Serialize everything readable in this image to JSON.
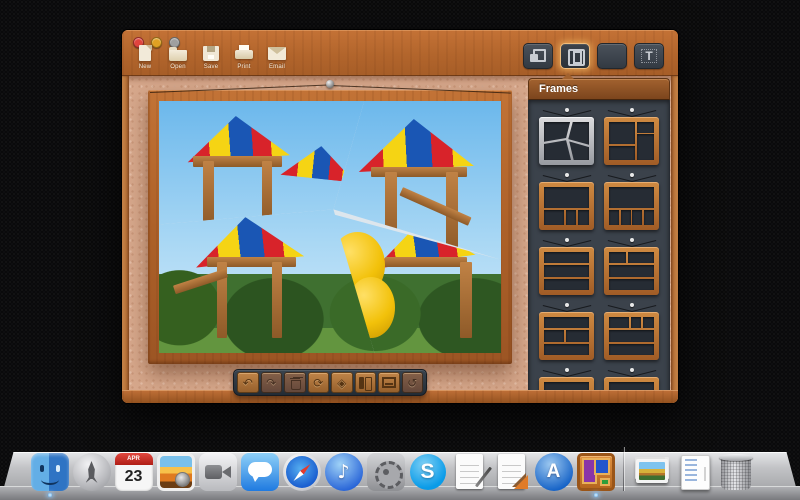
{
  "colors": {
    "wood_accent": "#b5692f",
    "cork": "#d7a88c",
    "panel_dark": "#3b424b",
    "selection_glow": "#eba95a"
  },
  "window": {
    "traffic_lights": [
      {
        "id": "close",
        "color": "#e0443e"
      },
      {
        "id": "minimize",
        "color": "#dfa123"
      },
      {
        "id": "zoom",
        "color": "#9f9f9f"
      }
    ],
    "toolbar": {
      "items": [
        {
          "id": "new",
          "label": "New"
        },
        {
          "id": "open",
          "label": "Open"
        },
        {
          "id": "save",
          "label": "Save"
        },
        {
          "id": "print",
          "label": "Print"
        },
        {
          "id": "email",
          "label": "Email"
        }
      ]
    },
    "view_buttons": [
      {
        "id": "layouts",
        "selected": false
      },
      {
        "id": "frames",
        "selected": true
      },
      {
        "id": "adjustments",
        "selected": false
      },
      {
        "id": "text",
        "glyph": "T",
        "selected": false
      }
    ],
    "frames_panel": {
      "title": "Frames",
      "thumbnails": [
        {
          "id": "diagonal-collage",
          "selected": true,
          "diagonal": true
        },
        {
          "id": "hero-left-right-column",
          "selected": false,
          "cells": [
            [
              0,
              0,
              58,
              58
            ],
            [
              62,
              0,
              38,
              28
            ],
            [
              62,
              32,
              38,
              68
            ],
            [
              0,
              62,
              58,
              38
            ]
          ]
        },
        {
          "id": "top-hero-bottom-three",
          "selected": false,
          "cells": [
            [
              0,
              0,
              100,
              55
            ],
            [
              0,
              60,
              44,
              40
            ],
            [
              48,
              60,
              24,
              40
            ],
            [
              76,
              60,
              24,
              40
            ]
          ]
        },
        {
          "id": "top-hero-bottom-four",
          "selected": false,
          "cells": [
            [
              0,
              0,
              100,
              55
            ],
            [
              0,
              60,
              22,
              40
            ],
            [
              26,
              60,
              22,
              40
            ],
            [
              52,
              60,
              22,
              40
            ],
            [
              78,
              60,
              22,
              40
            ]
          ]
        },
        {
          "id": "three-rows",
          "selected": false,
          "cells": [
            [
              0,
              0,
              100,
              30
            ],
            [
              0,
              35,
              100,
              30
            ],
            [
              0,
              70,
              100,
              30
            ]
          ]
        },
        {
          "id": "split-top-two-rows",
          "selected": false,
          "cells": [
            [
              0,
              0,
              38,
              30
            ],
            [
              42,
              0,
              58,
              30
            ],
            [
              0,
              35,
              100,
              30
            ],
            [
              0,
              70,
              100,
              30
            ]
          ]
        },
        {
          "id": "row-split-middle-row",
          "selected": false,
          "cells": [
            [
              0,
              0,
              100,
              30
            ],
            [
              0,
              35,
              44,
              30
            ],
            [
              48,
              35,
              52,
              30
            ],
            [
              0,
              70,
              100,
              30
            ]
          ]
        },
        {
          "id": "top-three-two-rows",
          "selected": false,
          "cells": [
            [
              0,
              0,
              44,
              30
            ],
            [
              48,
              0,
              24,
              30
            ],
            [
              76,
              0,
              24,
              30
            ],
            [
              0,
              35,
              100,
              30
            ],
            [
              0,
              70,
              100,
              30
            ]
          ]
        },
        {
          "id": "row-bottom-grid",
          "selected": false,
          "cells": [
            [
              0,
              0,
              100,
              30
            ],
            [
              0,
              35,
              46,
              30
            ],
            [
              50,
              35,
              50,
              30
            ],
            [
              0,
              70,
              46,
              30
            ],
            [
              50,
              70,
              50,
              30
            ]
          ]
        },
        {
          "id": "row-hero-right-column",
          "selected": false,
          "cells": [
            [
              0,
              0,
              100,
              30
            ],
            [
              0,
              35,
              62,
              65
            ],
            [
              66,
              35,
              34,
              29
            ],
            [
              66,
              68,
              34,
              32
            ]
          ]
        }
      ]
    },
    "tray": {
      "buttons": [
        {
          "id": "undo",
          "glyph": "↶",
          "enabled": true
        },
        {
          "id": "redo",
          "glyph": "↷",
          "enabled": false
        },
        {
          "id": "delete",
          "glyph": "",
          "enabled": false
        },
        {
          "id": "rotate",
          "glyph": "⟳",
          "enabled": true
        },
        {
          "id": "orientation",
          "glyph": "◈",
          "enabled": true
        },
        {
          "id": "swap",
          "glyph": "",
          "enabled": true
        },
        {
          "id": "border",
          "glyph": "",
          "enabled": true
        },
        {
          "id": "reset",
          "glyph": "↺",
          "enabled": false
        }
      ]
    }
  },
  "dock": {
    "items": [
      {
        "type": "app",
        "id": "finder",
        "running": true
      },
      {
        "type": "app",
        "id": "launchpad",
        "running": false
      },
      {
        "type": "app",
        "id": "calendar",
        "running": false,
        "month": "APR",
        "day": "23"
      },
      {
        "type": "app",
        "id": "iphoto",
        "running": false
      },
      {
        "type": "app",
        "id": "facetime",
        "running": false
      },
      {
        "type": "app",
        "id": "messages",
        "running": false
      },
      {
        "type": "app",
        "id": "safari",
        "running": false
      },
      {
        "type": "app",
        "id": "itunes",
        "running": false,
        "glyph": "♪"
      },
      {
        "type": "app",
        "id": "sysprefs",
        "running": false
      },
      {
        "type": "app",
        "id": "skype",
        "running": false,
        "letter": "S"
      },
      {
        "type": "app",
        "id": "textedit",
        "running": false
      },
      {
        "type": "app",
        "id": "pages",
        "running": false
      },
      {
        "type": "app",
        "id": "appstore",
        "running": false,
        "letter": "A"
      },
      {
        "type": "app",
        "id": "imageframer",
        "running": true
      },
      {
        "type": "divider",
        "id": "divider"
      },
      {
        "type": "stack",
        "id": "photostack"
      },
      {
        "type": "stack",
        "id": "docstack"
      },
      {
        "type": "trash",
        "id": "trash"
      }
    ]
  }
}
